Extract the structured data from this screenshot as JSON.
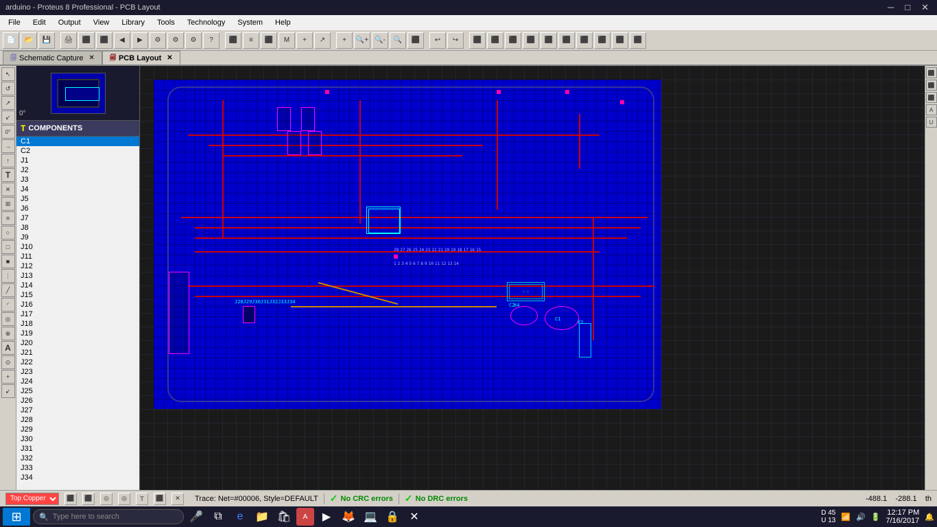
{
  "titleBar": {
    "title": "arduino - Proteus 8 Professional - PCB Layout",
    "controls": [
      "─",
      "□",
      "✕"
    ]
  },
  "menuBar": {
    "items": [
      "File",
      "Edit",
      "Output",
      "View",
      "Library",
      "Tools",
      "Technology",
      "System",
      "Help"
    ]
  },
  "tabs": [
    {
      "id": "schematic",
      "label": "Schematic Capture",
      "active": false
    },
    {
      "id": "pcb",
      "label": "PCB Layout",
      "active": true
    }
  ],
  "sidebar": {
    "angle": "0°",
    "componentsHeader": "COMPONENTS",
    "components": [
      "C1",
      "C2",
      "J1",
      "J2",
      "J3",
      "J4",
      "J5",
      "J6",
      "J7",
      "J8",
      "J9",
      "J10",
      "J11",
      "J12",
      "J13",
      "J14",
      "J15",
      "J16",
      "J17",
      "J18",
      "J19",
      "J20",
      "J21",
      "J22",
      "J23",
      "J24",
      "J25",
      "J26",
      "J27",
      "J28",
      "J29",
      "J30",
      "J31",
      "J32",
      "J33",
      "J34"
    ],
    "selectedComponent": "C1"
  },
  "statusBar": {
    "layer": "Top Copper",
    "traceInfo": "Trace: Net=#00006, Style=DEFAULT",
    "crcStatus": "No CRC errors",
    "drcStatus": "No DRC errors",
    "x": "-488.1",
    "y": "-288.1",
    "zoom": "th"
  },
  "taskbar": {
    "searchPlaceholder": "Type here to search",
    "clock": "12:17 PM",
    "date": "7/16/2017"
  }
}
